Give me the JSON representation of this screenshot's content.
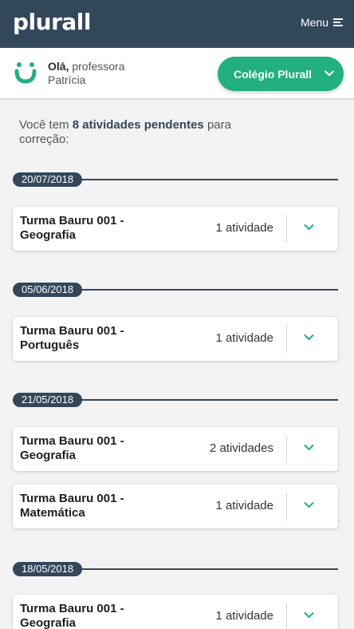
{
  "header": {
    "logo": "plurall",
    "menu_label": "Menu"
  },
  "greeting": {
    "hello": "Olá,",
    "role": "professora",
    "name": "Patrícia"
  },
  "school_button": {
    "label": "Colégio Plurall"
  },
  "summary": {
    "prefix": "Você tem",
    "highlight": "8 atividades pendentes",
    "suffix": "para correção:"
  },
  "groups": [
    {
      "date": "20/07/2018",
      "items": [
        {
          "class_name": "Turma Bauru 001 -",
          "subject": "Geografia",
          "count": "1 atividade"
        }
      ]
    },
    {
      "date": "05/06/2018",
      "items": [
        {
          "class_name": "Turma Bauru 001 -",
          "subject": "Português",
          "count": "1 atividade"
        }
      ]
    },
    {
      "date": "21/05/2018",
      "items": [
        {
          "class_name": "Turma Bauru 001 -",
          "subject": "Geografia",
          "count": "2 atividades"
        },
        {
          "class_name": "Turma Bauru 001 -",
          "subject": "Matemática",
          "count": "1 atividade"
        }
      ]
    },
    {
      "date": "18/05/2018",
      "items": [
        {
          "class_name": "Turma Bauru 001 -",
          "subject": "Geografia",
          "count": "1 atividade"
        }
      ]
    }
  ],
  "colors": {
    "header_bg": "#33475b",
    "accent": "#21b07e",
    "page_bg": "#f3f3f3"
  },
  "icons": {
    "menu": "hamburger-icon",
    "expand": "chevron-down-icon",
    "logo_mark": "smile-icon"
  }
}
